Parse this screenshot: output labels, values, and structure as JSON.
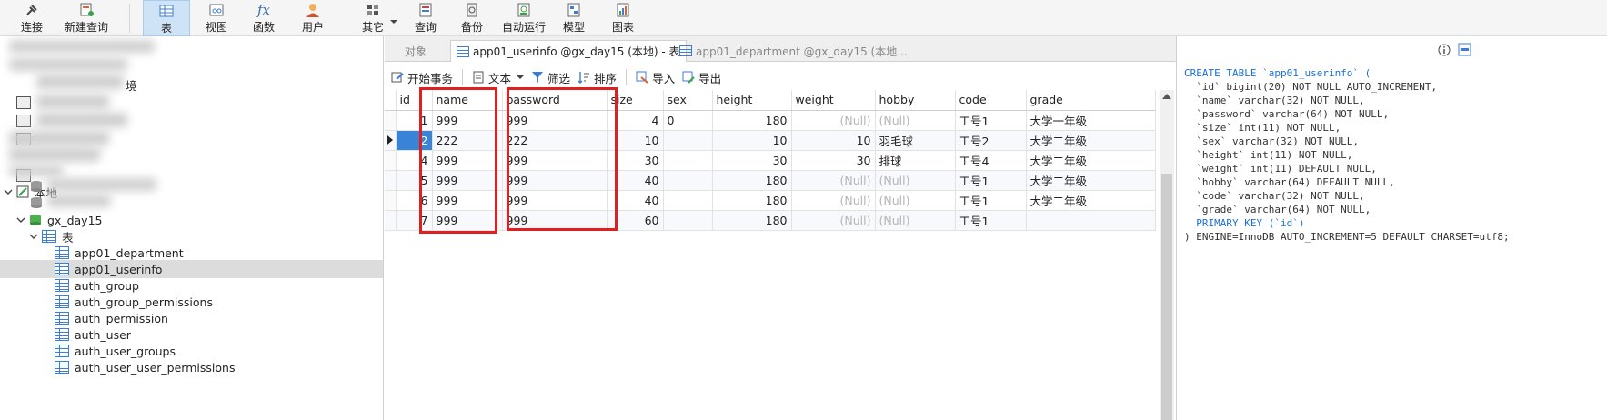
{
  "toolbar": {
    "items": [
      {
        "label": "连接",
        "icon": "plug-icon"
      },
      {
        "label": "新建查询",
        "icon": "new-query-icon"
      },
      {
        "label": "表",
        "icon": "table-icon",
        "active": true
      },
      {
        "label": "视图",
        "icon": "view-icon"
      },
      {
        "label": "函数",
        "icon": "function-icon"
      },
      {
        "label": "用户",
        "icon": "user-icon"
      },
      {
        "label": "其它",
        "icon": "other-icon"
      },
      {
        "label": "查询",
        "icon": "query-icon"
      },
      {
        "label": "备份",
        "icon": "backup-icon"
      },
      {
        "label": "自动运行",
        "icon": "auto-run-icon"
      },
      {
        "label": "模型",
        "icon": "model-icon"
      },
      {
        "label": "图表",
        "icon": "chart-icon"
      }
    ]
  },
  "nav": {
    "connection": "本地",
    "database": "gx_day15",
    "tables_folder": "表",
    "tables": [
      "app01_department",
      "app01_userinfo",
      "auth_group",
      "auth_group_permissions",
      "auth_permission",
      "auth_user",
      "auth_user_groups",
      "auth_user_user_permissions"
    ],
    "selected_table": "app01_userinfo",
    "partial_text": "境"
  },
  "tabs": {
    "objects": "对象",
    "active": "app01_userinfo @gx_day15 (本地) - 表",
    "inactive": "app01_department @gx_day15 (本地..."
  },
  "subtoolbar": {
    "begin_transaction": "开始事务",
    "text": "文本",
    "filter": "筛选",
    "sort": "排序",
    "import": "导入",
    "export": "导出"
  },
  "grid": {
    "columns": [
      "id",
      "name",
      "password",
      "size",
      "sex",
      "height",
      "weight",
      "hobby",
      "code",
      "grade"
    ],
    "rows": [
      {
        "id": "1",
        "name": "999",
        "password": "999",
        "size": "4",
        "sex": "0",
        "height": "180",
        "weight": "(Null)",
        "hobby": "(Null)",
        "code": "工号1",
        "grade": "大学一年级"
      },
      {
        "id": "2",
        "name": "222",
        "password": "222",
        "size": "10",
        "sex": "",
        "height": "10",
        "weight": "10",
        "hobby": "羽毛球",
        "code": "工号2",
        "grade": "大学二年级"
      },
      {
        "id": "4",
        "name": "999",
        "password": "999",
        "size": "30",
        "sex": "",
        "height": "30",
        "weight": "30",
        "hobby": "排球",
        "code": "工号4",
        "grade": "大学二年级"
      },
      {
        "id": "5",
        "name": "999",
        "password": "999",
        "size": "40",
        "sex": "",
        "height": "180",
        "weight": "(Null)",
        "hobby": "(Null)",
        "code": "工号1",
        "grade": "大学二年级"
      },
      {
        "id": "6",
        "name": "999",
        "password": "999",
        "size": "40",
        "sex": "",
        "height": "180",
        "weight": "(Null)",
        "hobby": "(Null)",
        "code": "工号1",
        "grade": "大学二年级"
      },
      {
        "id": "7",
        "name": "999",
        "password": "999",
        "size": "60",
        "sex": "",
        "height": "180",
        "weight": "(Null)",
        "hobby": "(Null)",
        "code": "工号1",
        "grade": ""
      }
    ],
    "current_row_id": "2",
    "highlight_color": "#e02020",
    "selection_color": "#3a84d8"
  },
  "ddl": {
    "lines": [
      "CREATE TABLE `app01_userinfo` (",
      "  `id` bigint(20) NOT NULL AUTO_INCREMENT,",
      "  `name` varchar(32) NOT NULL,",
      "  `password` varchar(64) NOT NULL,",
      "  `size` int(11) NOT NULL,",
      "  `sex` varchar(32) NOT NULL,",
      "  `height` int(11) NOT NULL,",
      "  `weight` int(11) DEFAULT NULL,",
      "  `hobby` varchar(64) DEFAULT NULL,",
      "  `code` varchar(32) NOT NULL,",
      "  `grade` varchar(64) NOT NULL,",
      "  PRIMARY KEY (`id`)",
      ") ENGINE=InnoDB AUTO_INCREMENT=5 DEFAULT CHARSET=utf8;"
    ]
  }
}
